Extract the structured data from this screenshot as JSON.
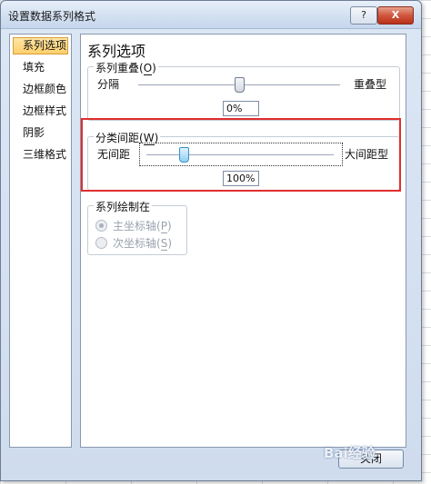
{
  "window": {
    "title": "设置数据系列格式",
    "help_label": "?",
    "close_label": "X"
  },
  "sidebar": {
    "items": [
      {
        "label": "系列选项",
        "active": true
      },
      {
        "label": "填充",
        "active": false
      },
      {
        "label": "边框颜色",
        "active": false
      },
      {
        "label": "边框样式",
        "active": false
      },
      {
        "label": "阴影",
        "active": false
      },
      {
        "label": "三维格式",
        "active": false
      }
    ]
  },
  "main": {
    "section_title": "系列选项",
    "overlap": {
      "legend": "系列重叠",
      "hotkey": "O",
      "left_label": "分隔",
      "right_label": "重叠型",
      "value_text": "0%",
      "position_fraction": 0.5
    },
    "gap": {
      "legend": "分类间距",
      "hotkey": "W",
      "left_label": "无间距",
      "right_label": "大间距型",
      "value_text": "100%",
      "position_fraction": 0.2
    },
    "plot_on": {
      "legend": "系列绘制在",
      "options": [
        {
          "label": "主坐标轴",
          "hotkey": "P",
          "checked": true
        },
        {
          "label": "次坐标轴",
          "hotkey": "S",
          "checked": false
        }
      ]
    }
  },
  "footer": {
    "close_button_label": "关闭"
  },
  "watermark": {
    "text": "Bai经验"
  },
  "colors": {
    "highlight": "#e02e2e",
    "active_tab": "#ffcf6b"
  }
}
